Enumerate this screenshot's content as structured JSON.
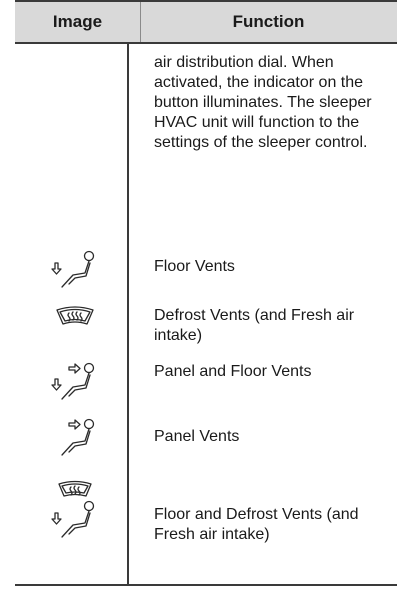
{
  "table": {
    "headers": {
      "image": "Image",
      "function": "Function"
    },
    "continuation_text": "air distribution dial. When activated, the indicator on the button illuminates. The sleeper HVAC unit will function to the settings of the sleeper control.",
    "rows": [
      {
        "icon": "floor-vents-icon",
        "label": "Floor Vents"
      },
      {
        "icon": "defrost-vents-icon",
        "label": "Defrost Vents (and Fresh air intake)"
      },
      {
        "icon": "panel-and-floor-vents-icon",
        "label": "Panel and Floor Vents"
      },
      {
        "icon": "panel-vents-icon",
        "label": "Panel Vents"
      },
      {
        "icon": "floor-and-defrost-vents-icon",
        "label": "Floor and Defrost Vents (and Fresh air intake)"
      }
    ]
  }
}
